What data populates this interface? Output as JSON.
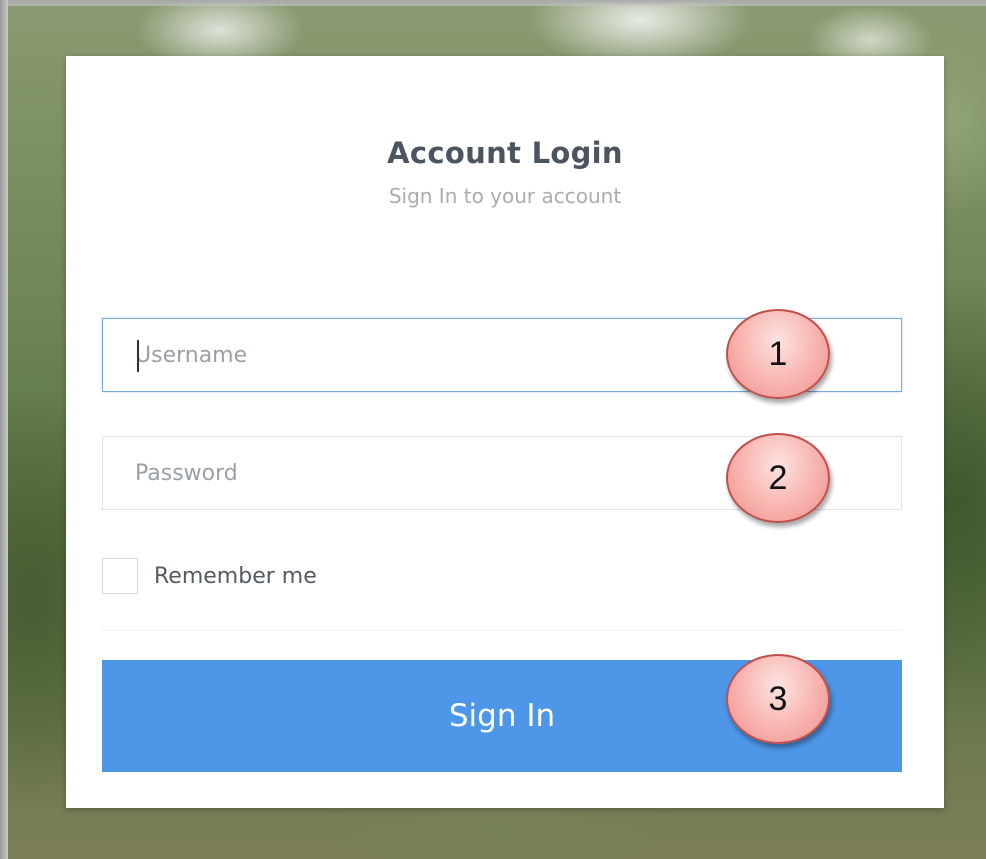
{
  "login": {
    "title": "Account Login",
    "subtitle": "Sign In to your account",
    "username": {
      "placeholder": "Username",
      "value": ""
    },
    "password": {
      "placeholder": "Password",
      "value": ""
    },
    "remember": {
      "label": "Remember me",
      "checked": false
    },
    "submit_label": "Sign In"
  },
  "markers": [
    {
      "label": "1"
    },
    {
      "label": "2"
    },
    {
      "label": "3"
    }
  ],
  "colors": {
    "accent": "#4d96e8",
    "focus_border": "#76a9dc",
    "marker_fill": "#f8b3ae",
    "marker_border": "#c0504d"
  }
}
